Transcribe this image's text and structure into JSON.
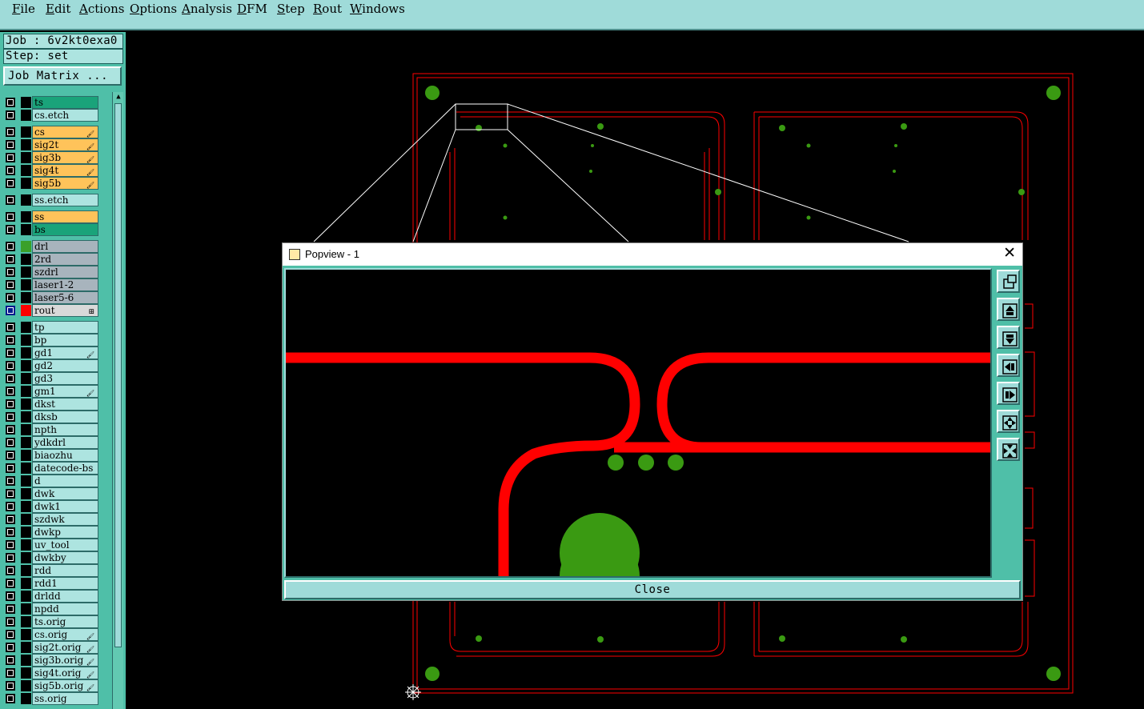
{
  "menu": [
    "File",
    "Edit",
    "Actions",
    "Options",
    "Analysis",
    "DFM",
    "Step",
    "Rout",
    "Windows"
  ],
  "menu_mnemonics": [
    "F",
    "E",
    "A",
    "O",
    "A",
    "D",
    "S",
    "R",
    "W"
  ],
  "job": {
    "label": "Job : 6v2kt0exa0",
    "step": "Step: set"
  },
  "job_matrix_button": "Job Matrix ...",
  "layers": [
    {
      "name": "ts",
      "color": "#1aa37a",
      "swatch": "#000000",
      "mark": ""
    },
    {
      "name": "cs.etch",
      "color": "#ade4e0",
      "swatch": "#000000",
      "mark": ""
    },
    {
      "name": "cs",
      "color": "#ffc35a",
      "swatch": "#000000",
      "mark": "flame"
    },
    {
      "name": "sig2t",
      "color": "#ffc35a",
      "swatch": "#000000",
      "mark": "flame"
    },
    {
      "name": "sig3b",
      "color": "#ffc35a",
      "swatch": "#000000",
      "mark": "flame"
    },
    {
      "name": "sig4t",
      "color": "#ffc35a",
      "swatch": "#000000",
      "mark": "flame"
    },
    {
      "name": "sig5b",
      "color": "#ffc35a",
      "swatch": "#000000",
      "mark": "flame"
    },
    {
      "name": "ss.etch",
      "color": "#ade4e0",
      "swatch": "#000000",
      "mark": ""
    },
    {
      "name": "ss",
      "color": "#ffc35a",
      "swatch": "#000000",
      "mark": ""
    },
    {
      "name": "bs",
      "color": "#1aa37a",
      "swatch": "#000000",
      "mark": ""
    },
    {
      "name": "drl",
      "color": "#a8b4bd",
      "swatch": "#3aa02a",
      "mark": ""
    },
    {
      "name": "2rd",
      "color": "#a8b4bd",
      "swatch": "#000000",
      "mark": ""
    },
    {
      "name": "szdrl",
      "color": "#a8b4bd",
      "swatch": "#000000",
      "mark": ""
    },
    {
      "name": "laser1-2",
      "color": "#a8b4bd",
      "swatch": "#000000",
      "mark": ""
    },
    {
      "name": "laser5-6",
      "color": "#a8b4bd",
      "swatch": "#000000",
      "mark": ""
    },
    {
      "name": "rout",
      "color": "#d9d9d9",
      "swatch": "#ff0000",
      "mark": "grid",
      "active": true
    },
    {
      "name": "tp",
      "color": "#ade4e0",
      "swatch": "#000000",
      "mark": ""
    },
    {
      "name": "bp",
      "color": "#ade4e0",
      "swatch": "#000000",
      "mark": ""
    },
    {
      "name": "gd1",
      "color": "#ade4e0",
      "swatch": "#000000",
      "mark": "flame"
    },
    {
      "name": "gd2",
      "color": "#ade4e0",
      "swatch": "#000000",
      "mark": ""
    },
    {
      "name": "gd3",
      "color": "#ade4e0",
      "swatch": "#000000",
      "mark": ""
    },
    {
      "name": "gm1",
      "color": "#ade4e0",
      "swatch": "#000000",
      "mark": "flame"
    },
    {
      "name": "dkst",
      "color": "#ade4e0",
      "swatch": "#000000",
      "mark": ""
    },
    {
      "name": "dksb",
      "color": "#ade4e0",
      "swatch": "#000000",
      "mark": ""
    },
    {
      "name": "npth",
      "color": "#ade4e0",
      "swatch": "#000000",
      "mark": ""
    },
    {
      "name": "ydkdrl",
      "color": "#ade4e0",
      "swatch": "#000000",
      "mark": ""
    },
    {
      "name": "biaozhu",
      "color": "#ade4e0",
      "swatch": "#000000",
      "mark": ""
    },
    {
      "name": "datecode-bs",
      "color": "#ade4e0",
      "swatch": "#000000",
      "mark": ""
    },
    {
      "name": "d",
      "color": "#ade4e0",
      "swatch": "#000000",
      "mark": ""
    },
    {
      "name": "dwk",
      "color": "#ade4e0",
      "swatch": "#000000",
      "mark": ""
    },
    {
      "name": "dwk1",
      "color": "#ade4e0",
      "swatch": "#000000",
      "mark": ""
    },
    {
      "name": "szdwk",
      "color": "#ade4e0",
      "swatch": "#000000",
      "mark": ""
    },
    {
      "name": "dwkp",
      "color": "#ade4e0",
      "swatch": "#000000",
      "mark": ""
    },
    {
      "name": "uv_tool",
      "color": "#ade4e0",
      "swatch": "#000000",
      "mark": ""
    },
    {
      "name": "dwkby",
      "color": "#ade4e0",
      "swatch": "#000000",
      "mark": ""
    },
    {
      "name": "rdd",
      "color": "#ade4e0",
      "swatch": "#000000",
      "mark": ""
    },
    {
      "name": "rdd1",
      "color": "#ade4e0",
      "swatch": "#000000",
      "mark": ""
    },
    {
      "name": "drldd",
      "color": "#ade4e0",
      "swatch": "#000000",
      "mark": ""
    },
    {
      "name": "npdd",
      "color": "#ade4e0",
      "swatch": "#000000",
      "mark": ""
    },
    {
      "name": "ts.orig",
      "color": "#ade4e0",
      "swatch": "#000000",
      "mark": ""
    },
    {
      "name": "cs.orig",
      "color": "#ade4e0",
      "swatch": "#000000",
      "mark": "flame"
    },
    {
      "name": "sig2t.orig",
      "color": "#ade4e0",
      "swatch": "#000000",
      "mark": "flame"
    },
    {
      "name": "sig3b.orig",
      "color": "#ade4e0",
      "swatch": "#000000",
      "mark": "flame"
    },
    {
      "name": "sig4t.orig",
      "color": "#ade4e0",
      "swatch": "#000000",
      "mark": "flame"
    },
    {
      "name": "sig5b.orig",
      "color": "#ade4e0",
      "swatch": "#000000",
      "mark": "flame"
    },
    {
      "name": "ss.orig",
      "color": "#ade4e0",
      "swatch": "#000000",
      "mark": ""
    }
  ],
  "popview": {
    "title": "Popview - 1",
    "close_label": "Close",
    "tools": [
      "zoom-home-icon",
      "pan-up-icon",
      "pan-down-icon",
      "pan-left-icon",
      "pan-right-icon",
      "zoom-in-icon",
      "zoom-out-icon"
    ]
  },
  "colors": {
    "rout": "#ff0000",
    "pad": "#3a9a12",
    "outline": "#ff0000",
    "zoom_frame": "#ffffff"
  }
}
